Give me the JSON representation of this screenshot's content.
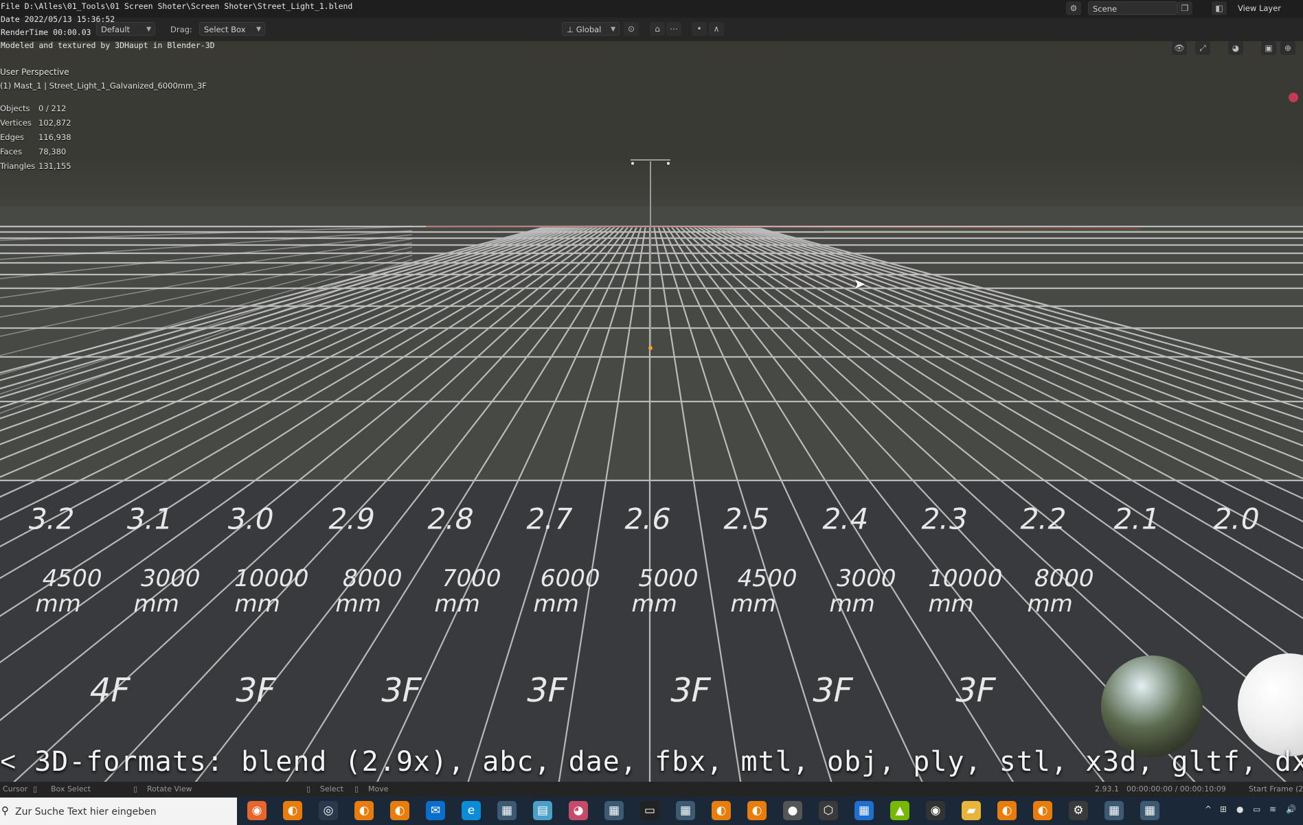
{
  "window": {
    "file_line": "File D:\\Alles\\01_Tools\\01 Screen Shoter\\Screen Shoter\\Street_Light_1.blend",
    "date_line": "Date 2022/05/13 15:36:52",
    "render_line": "RenderTime 00:00.03",
    "credit_line": "Modeled and textured by 3DHaupt in Blender-3D"
  },
  "toolbar": {
    "orientation_value": "Default",
    "drag_label": "Drag:",
    "drag_value": "Select Box",
    "transform_orientation": "Global",
    "scene_name": "Scene",
    "view_layer": "View Layer"
  },
  "viewport": {
    "perspective": "User Perspective",
    "active_object": "(1) Mast_1 | Street_Light_1_Galvanized_6000mm_3F",
    "stats": [
      {
        "label": "Objects",
        "value": "0 / 212"
      },
      {
        "label": "Vertices",
        "value": "102,872"
      },
      {
        "label": "Edges",
        "value": "116,938"
      },
      {
        "label": "Faces",
        "value": "78,380"
      },
      {
        "label": "Triangles",
        "value": "131,155"
      }
    ]
  },
  "ground_labels": {
    "numbers": [
      "3.2",
      "3.1",
      "3.0",
      "2.9",
      "2.8",
      "2.7",
      "2.6",
      "2.5",
      "2.4",
      "2.3",
      "2.2",
      "2.1",
      "2.0"
    ],
    "lengths": [
      "4500",
      "3000",
      "10000",
      "8000",
      "7000",
      "6000",
      "5000",
      "4500",
      "3000",
      "10000",
      "8000"
    ],
    "unit": "mm",
    "floors": [
      "4F",
      "3F",
      "3F",
      "3F",
      "3F",
      "3F",
      "3F"
    ]
  },
  "subtitle": "3D-formats: blend (2.9x), abc, dae, fbx, mtl, obj, ply, stl, x3d, gltf, dxf",
  "status_bar": {
    "cursor": "Cursor",
    "box_select": "Box Select",
    "rotate_view": "Rotate View",
    "select": "Select",
    "move": "Move",
    "version": "2.93.1",
    "timecode": "00:00:00:00 / 00:00:10:09",
    "start_frame": "Start Frame (2"
  },
  "taskbar": {
    "search_placeholder": "Zur Suche Text hier eingeben",
    "icons": [
      "firefox-icon",
      "blender-icon",
      "steam-icon",
      "blender-icon",
      "blender-icon",
      "mail-icon",
      "edge-icon",
      "app-icon",
      "notes-icon",
      "chat-icon",
      "app-icon",
      "terminal-icon",
      "app-icon",
      "blender-icon",
      "blender-icon",
      "panda-icon",
      "cube-icon",
      "calendar-icon",
      "nvidia-icon",
      "obs-icon",
      "folder-icon",
      "blender-icon",
      "blender-icon",
      "settings-icon",
      "app-icon",
      "app-icon"
    ]
  }
}
